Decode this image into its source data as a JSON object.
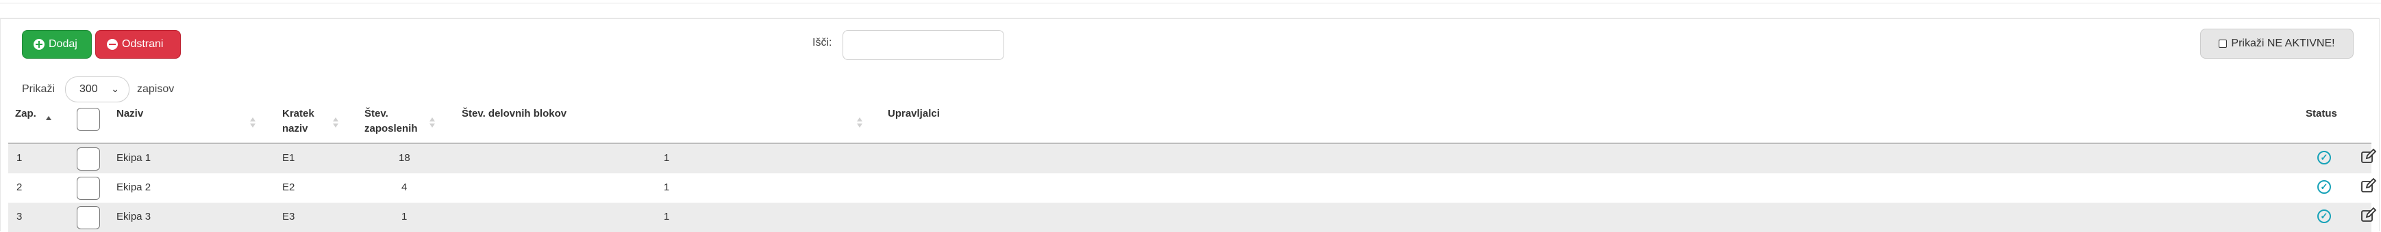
{
  "toolbar": {
    "add_label": "Dodaj",
    "remove_label": "Odstrani",
    "search_label": "Išči:",
    "search_value": "",
    "inactive_label": "Prikaži NE AKTIVNE!"
  },
  "length": {
    "prefix": "Prikaži",
    "value": "300",
    "suffix": "zapisov"
  },
  "table": {
    "headers": {
      "zap": "Zap.",
      "naziv": "Naziv",
      "kratek_1": "Kratek",
      "kratek_2": "naziv",
      "stev_1": "Štev.",
      "stev_2": "zaposlenih",
      "blokov": "Štev. delovnih blokov",
      "upravljalci": "Upravljalci",
      "status": "Status"
    },
    "rows": [
      {
        "zap": "1",
        "naziv": "Ekipa 1",
        "kratek": "E1",
        "zaposlenih": "18",
        "blokov": "1",
        "upravljalci": ""
      },
      {
        "zap": "2",
        "naziv": "Ekipa 2",
        "kratek": "E2",
        "zaposlenih": "4",
        "blokov": "1",
        "upravljalci": ""
      },
      {
        "zap": "3",
        "naziv": "Ekipa 3",
        "kratek": "E3",
        "zaposlenih": "1",
        "blokov": "1",
        "upravljalci": ""
      }
    ]
  },
  "icons": {
    "add": "plus-circle-icon",
    "remove": "minus-circle-icon",
    "status": "check-circle-icon",
    "edit": "edit-icon"
  },
  "colors": {
    "add": "#28a745",
    "remove": "#dc3545",
    "status": "#17a2b8"
  }
}
